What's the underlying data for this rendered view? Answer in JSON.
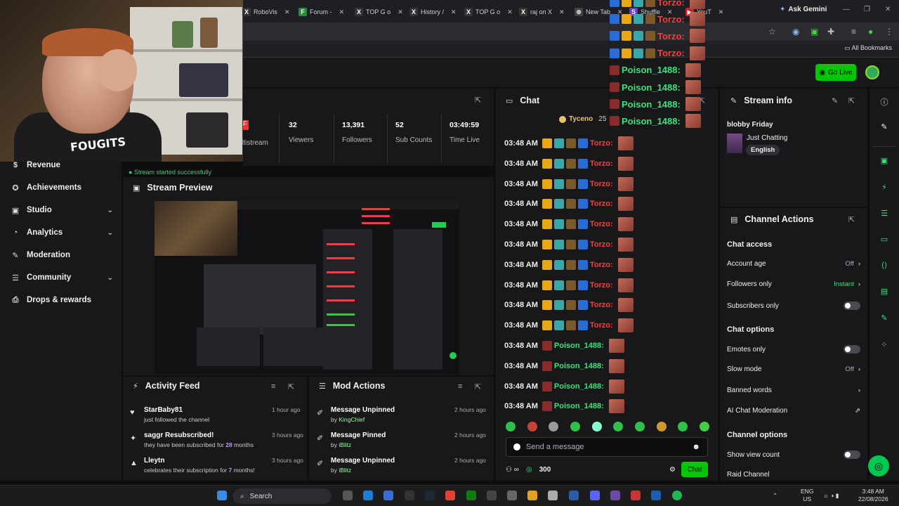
{
  "browser": {
    "tabs": [
      {
        "label": "RoboVis",
        "icon": "X"
      },
      {
        "label": "Forum -",
        "icon": "F"
      },
      {
        "label": "TOP G o",
        "icon": "X"
      },
      {
        "label": "History /",
        "icon": "X"
      },
      {
        "label": "TOP G o",
        "icon": "X"
      },
      {
        "label": "raj on X",
        "icon": "X"
      },
      {
        "label": "New Tab",
        "icon": "⊕"
      },
      {
        "label": "Shuffle",
        "icon": "S"
      },
      {
        "label": "YouT",
        "icon": "▶"
      }
    ],
    "ask_gemini": "Ask Gemini",
    "all_bookmarks": "All Bookmarks"
  },
  "topnav": {
    "go_live": "Go Live"
  },
  "webcam": {
    "shirt_text": "FOUGITS"
  },
  "leftnav": {
    "items": [
      {
        "label": "Revenue",
        "icon": "$",
        "chevron": false
      },
      {
        "label": "Achievements",
        "icon": "✪",
        "chevron": false
      },
      {
        "label": "Studio",
        "icon": "▣",
        "chevron": true
      },
      {
        "label": "Analytics",
        "icon": "◔",
        "chevron": true
      },
      {
        "label": "Moderation",
        "icon": "✎",
        "chevron": false
      },
      {
        "label": "Community",
        "icon": "☰",
        "chevron": true
      },
      {
        "label": "Drops & rewards",
        "icon": "⎙",
        "chevron": false
      }
    ]
  },
  "stats": {
    "multistream": "ltistream",
    "items": [
      {
        "value": "32",
        "label": "Viewers"
      },
      {
        "value": "13,391",
        "label": "Followers"
      },
      {
        "value": "52",
        "label": "Sub Counts"
      },
      {
        "value": "03:49:59",
        "label": "Time Live"
      }
    ],
    "success_msg": "Stream started successfully"
  },
  "preview": {
    "title": "Stream Preview"
  },
  "activity": {
    "title": "Activity Feed",
    "items": [
      {
        "who": "StarBaby81",
        "sub": "just followed the channel",
        "time": "1 hour ago",
        "icon": "♥"
      },
      {
        "who": "saggr Resubscribed!",
        "sub_pre": "they have been subscribed for ",
        "sub_hl": "28",
        "sub_post": " months",
        "time": "3 hours ago",
        "icon": "✦"
      },
      {
        "who": "Lleytn",
        "sub_pre": "celebrates their subscription for ",
        "sub_hl": "7",
        "sub_post": " months!",
        "time": "3 hours ago",
        "icon": "▲"
      }
    ]
  },
  "mod": {
    "title": "Mod Actions",
    "items": [
      {
        "action": "Message Unpinned",
        "by": "KingChief",
        "time": "2 hours ago"
      },
      {
        "action": "Message Pinned",
        "by": "iBlitz",
        "time": "2 hours ago"
      },
      {
        "action": "Message Unpinned",
        "by": "iBlitz",
        "time": "2 hours ago"
      }
    ],
    "by_prefix": "by "
  },
  "chat": {
    "title": "Chat",
    "pinned_user": "Tyceno",
    "pinned_count": "25",
    "overlay_lines": [
      {
        "user": "Torzo:",
        "type": "torzo"
      },
      {
        "user": "Torzo:",
        "type": "torzo"
      },
      {
        "user": "Torzo:",
        "type": "torzo"
      },
      {
        "user": "Torzo:",
        "type": "torzo"
      },
      {
        "user": "Poison_1488:",
        "type": "poison"
      },
      {
        "user": "Poison_1488:",
        "type": "poison"
      },
      {
        "user": "Poison_1488:",
        "type": "poison"
      },
      {
        "user": "Poison_1488:",
        "type": "poison"
      }
    ],
    "messages": [
      {
        "time": "03:48 AM",
        "user": "Torzo:",
        "type": "torzo"
      },
      {
        "time": "03:48 AM",
        "user": "Torzo:",
        "type": "torzo"
      },
      {
        "time": "03:48 AM",
        "user": "Torzo:",
        "type": "torzo"
      },
      {
        "time": "03:48 AM",
        "user": "Torzo:",
        "type": "torzo"
      },
      {
        "time": "03:48 AM",
        "user": "Torzo:",
        "type": "torzo"
      },
      {
        "time": "03:48 AM",
        "user": "Torzo:",
        "type": "torzo"
      },
      {
        "time": "03:48 AM",
        "user": "Torzo:",
        "type": "torzo"
      },
      {
        "time": "03:48 AM",
        "user": "Torzo:",
        "type": "torzo"
      },
      {
        "time": "03:48 AM",
        "user": "Torzo:",
        "type": "torzo"
      },
      {
        "time": "03:48 AM",
        "user": "Torzo:",
        "type": "torzo"
      },
      {
        "time": "03:48 AM",
        "user": "Poison_1488:",
        "type": "poison"
      },
      {
        "time": "03:48 AM",
        "user": "Poison_1488:",
        "type": "poison"
      },
      {
        "time": "03:48 AM",
        "user": "Poison_1488:",
        "type": "poison"
      },
      {
        "time": "03:48 AM",
        "user": "Poison_1488:",
        "type": "poison"
      }
    ],
    "input_placeholder": "Send a message",
    "points": "300",
    "chat_button": "Chat"
  },
  "stream_info": {
    "title": "Stream info",
    "stream_title": "blobby Friday",
    "category": "Just Chatting",
    "tag": "English"
  },
  "channel_actions": {
    "title": "Channel Actions",
    "chat_access_heading": "Chat access",
    "account_age": {
      "label": "Account age",
      "value": "Off"
    },
    "followers_only": {
      "label": "Followers only",
      "value": "Instant"
    },
    "subscribers_only": {
      "label": "Subscribers only"
    },
    "chat_options_heading": "Chat options",
    "emotes_only": {
      "label": "Emotes only"
    },
    "slow_mode": {
      "label": "Slow mode",
      "value": "Off"
    },
    "banned_words": {
      "label": "Banned words"
    },
    "ai_moderation": {
      "label": "AI Chat Moderation"
    },
    "channel_options_heading": "Channel options",
    "show_view_count": {
      "label": "Show view count"
    },
    "raid_channel": {
      "label": "Raid Channel"
    }
  },
  "taskbar": {
    "search": "Search",
    "lang_top": "ENG",
    "lang_bottom": "US",
    "time": "3:48 AM",
    "date": "22/08/2026"
  }
}
